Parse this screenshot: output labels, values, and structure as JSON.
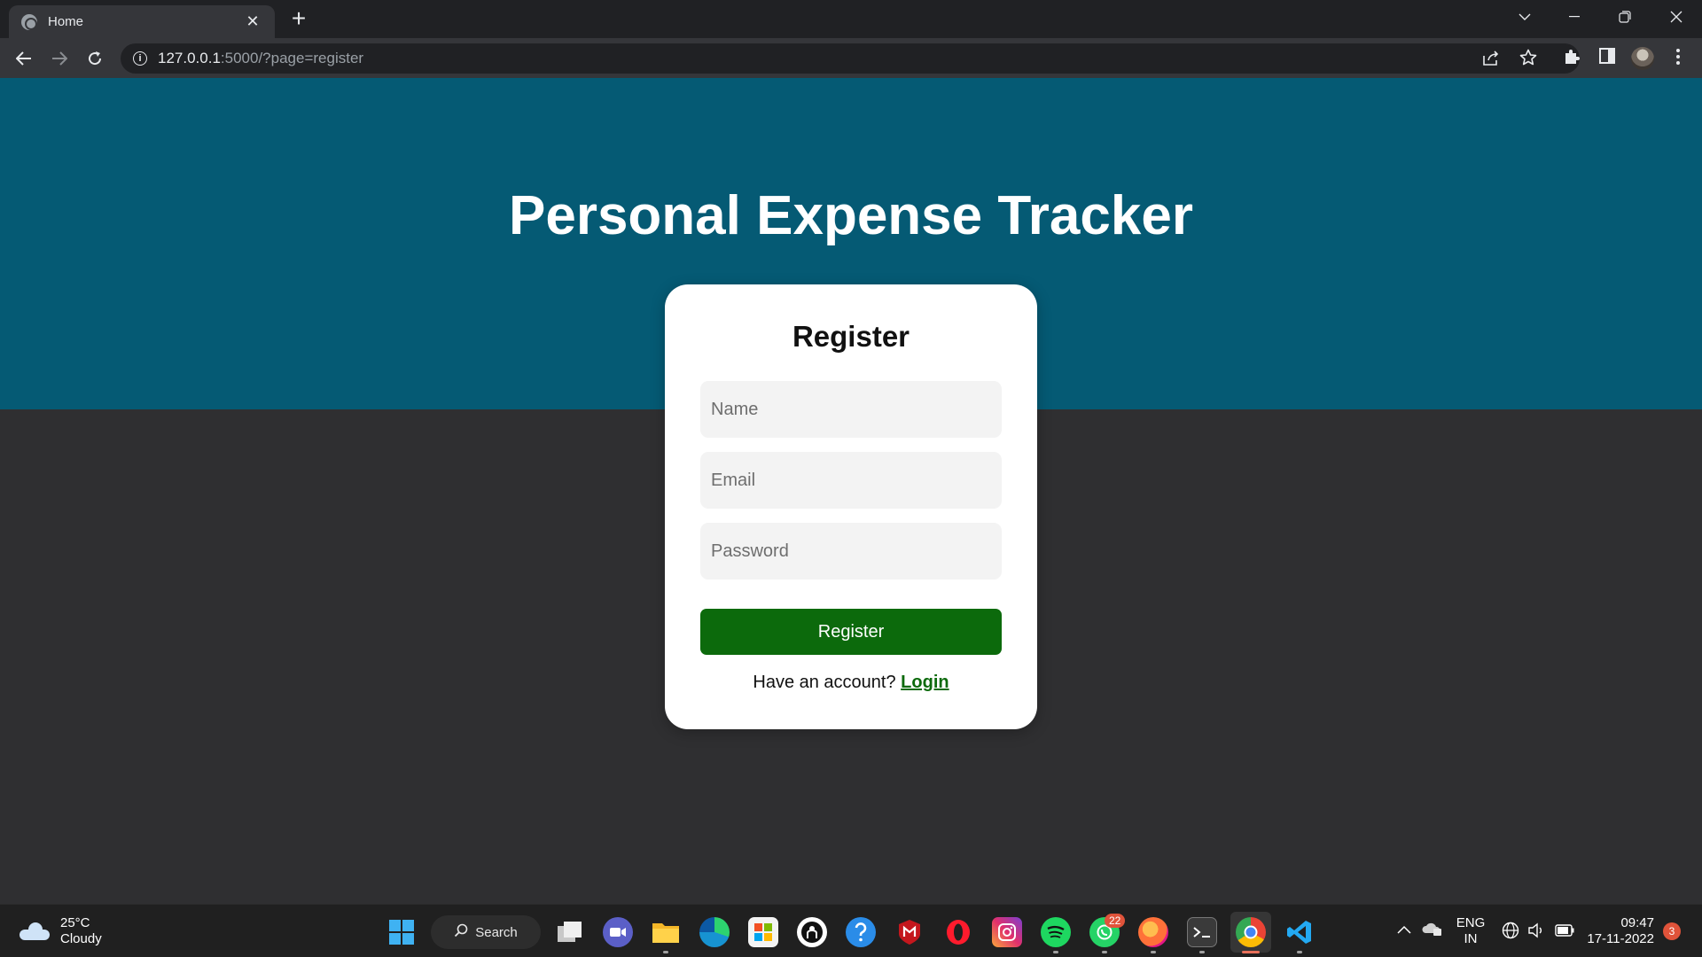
{
  "browser": {
    "tab_title": "Home",
    "tab_close": "✕",
    "new_tab": "+",
    "url_host": "127.0.0.1",
    "url_rest": ":5000/?page=register",
    "info_icon": "i"
  },
  "page": {
    "app_title": "Personal Expense Tracker",
    "form_title": "Register",
    "name_placeholder": "Name",
    "email_placeholder": "Email",
    "password_placeholder": "Password",
    "submit_label": "Register",
    "switch_prompt": "Have an account?",
    "switch_link": "Login"
  },
  "colors": {
    "hero": "#055a74",
    "background": "#2f2f31",
    "button": "#0c6a0c",
    "link": "#0c6a0c"
  },
  "taskbar": {
    "weather_temp": "25°C",
    "weather_desc": "Cloudy",
    "search_label": "Search",
    "whatsapp_badge": "22",
    "lang_line1": "ENG",
    "lang_line2": "IN",
    "time": "09:47",
    "date": "17-11-2022",
    "notification_count": "3"
  },
  "icons": [
    "globe-icon",
    "close-icon",
    "plus-icon",
    "chevron-down-icon",
    "minimize-icon",
    "restore-icon",
    "back-icon",
    "forward-icon",
    "reload-icon",
    "info-icon",
    "share-icon",
    "star-icon",
    "extensions-icon",
    "side-panel-icon",
    "profile-avatar",
    "more-icon",
    "cloud-icon",
    "windows-start-icon",
    "search-icon",
    "task-view-icon",
    "teams-icon",
    "file-explorer-icon",
    "edge-icon",
    "store-icon",
    "github-icon",
    "help-icon",
    "mcafee-icon",
    "opera-icon",
    "instagram-icon",
    "spotify-icon",
    "whatsapp-icon",
    "firefox-icon",
    "terminal-icon",
    "chrome-icon",
    "vscode-icon"
  ]
}
